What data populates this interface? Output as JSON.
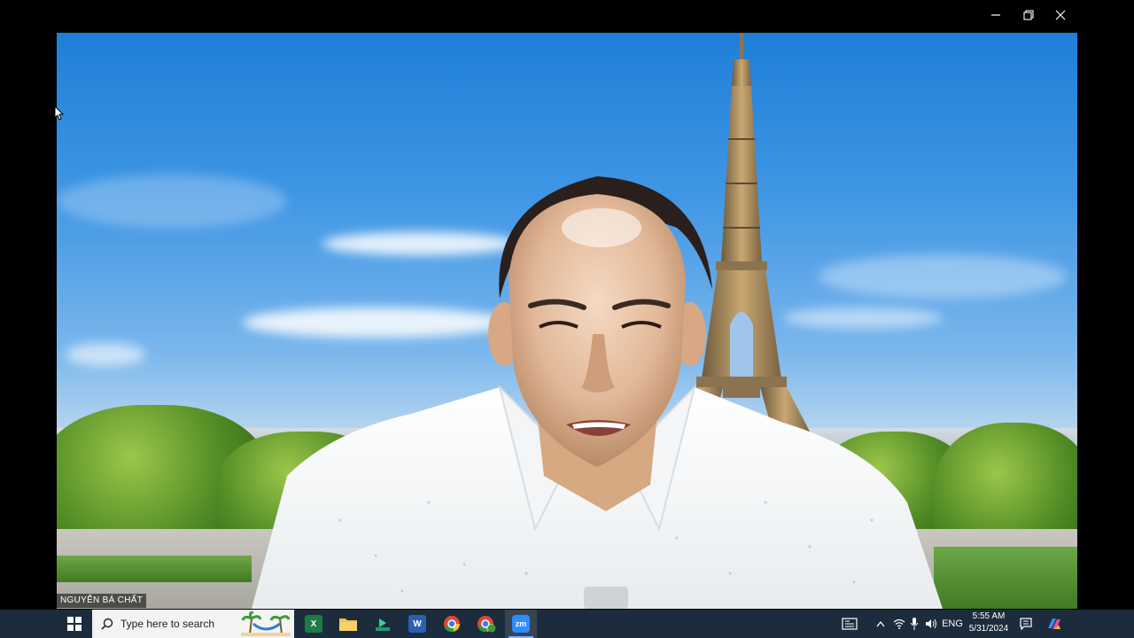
{
  "window": {
    "minimize_label": "Minimize",
    "restore_label": "Restore",
    "close_label": "Close"
  },
  "video": {
    "participant_name": "NGUYỄN BÁ CHẤT",
    "background": "eiffel-tower-virtual-background"
  },
  "taskbar": {
    "start_icon": "windows-start-icon",
    "search_placeholder": "Type here to search",
    "apps": [
      {
        "name": "excel",
        "label": "X",
        "color": "#1f7a44"
      },
      {
        "name": "file-explorer",
        "label": "",
        "color": "#f2c24a"
      },
      {
        "name": "terminal",
        "label": "",
        "color": "#1e9c6b"
      },
      {
        "name": "word",
        "label": "W",
        "color": "#2b5fb4"
      },
      {
        "name": "chrome",
        "label": "",
        "color": "#e0453a"
      },
      {
        "name": "chrome-profile",
        "label": "",
        "color": "#3a9a44"
      },
      {
        "name": "zoom",
        "label": "zm",
        "color": "#2d8cff"
      }
    ],
    "language": "ENG",
    "time": "5:55 AM",
    "date": "5/31/2024"
  }
}
